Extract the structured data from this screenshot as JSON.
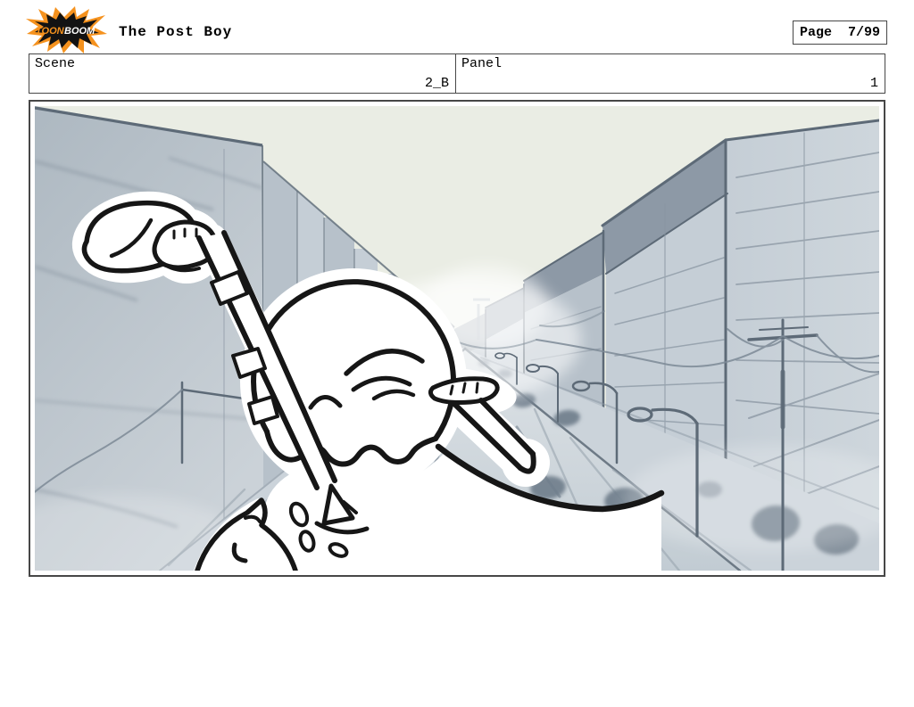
{
  "header": {
    "title": "The Post Boy",
    "page": {
      "label": "Page",
      "value": "7/99"
    },
    "logo": {
      "word1": "TOON",
      "word2": "BOOM"
    }
  },
  "fields": {
    "scene": {
      "label": "Scene",
      "value": "2_B"
    },
    "panel": {
      "label": "Panel",
      "value": "1"
    }
  },
  "artwork": {
    "alt": "Storyboard drawing: a round-headed post boy shields his eyes and looks down a city street that recedes to a vanishing point; he holds a bundle overhead; blue-gray buildings, street lamps, power lines and dark car silhouettes line the road",
    "colors": {
      "frame_border": "#474747",
      "sky": "#eaede4",
      "bldg_left_top": "#adb8c1",
      "bldg_left_bot": "#cbd2d8",
      "bldg_mid": "#b7c1ca",
      "bldg_light": "#c5ced6",
      "bldg_lighter": "#ced6dc",
      "roof_dark": "#8d99a6",
      "line_dark": "#5d6a77",
      "line_soft": "#8a96a2",
      "road_near": "#c2ccd3",
      "road_far": "#dde2e6",
      "sidewalk": "#cbd3da",
      "hatch": "#9aa6b0",
      "car": "#6f7d8b",
      "wire": "#7d8a96",
      "ink": "#161616",
      "white": "#ffffff",
      "logo_orange": "#f5921e",
      "logo_black": "#131313"
    }
  }
}
